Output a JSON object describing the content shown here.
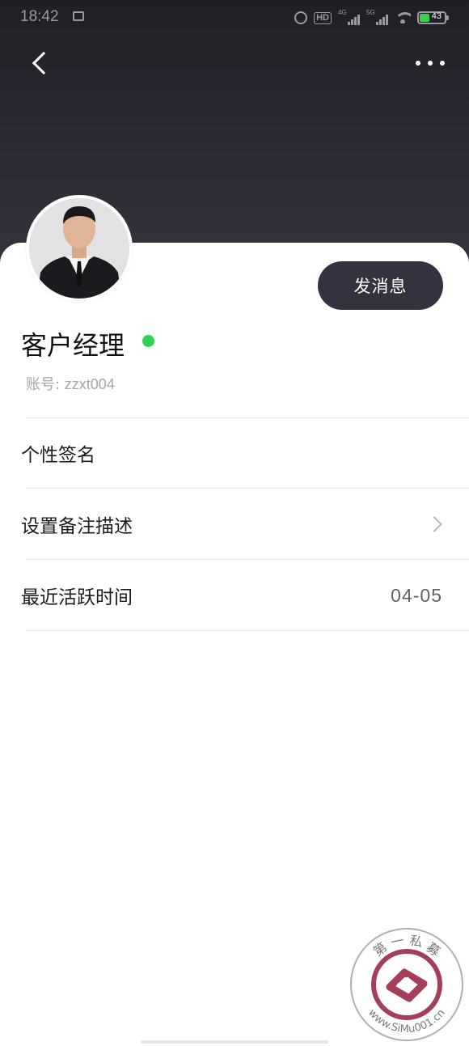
{
  "status_bar": {
    "time": "18:42",
    "hd_label": "HD",
    "net_4g": "4G",
    "net_5g": "5G",
    "battery": "43"
  },
  "nav": {
    "back_icon": "chevron-left-icon",
    "more_icon": "more-dots-icon"
  },
  "profile": {
    "name": "客户经理",
    "online": true,
    "online_color": "#2fd35a",
    "account_label": "账号: ",
    "account_id": "zzxt004",
    "send_message_label": "发消息"
  },
  "rows": [
    {
      "label": "个性签名",
      "value": ""
    },
    {
      "label": "设置备注描述",
      "value": "",
      "chevron": true
    },
    {
      "label": "最近活跃时间",
      "value": "04-05"
    }
  ],
  "watermark": {
    "text_top": "第 一 私 募",
    "text_bottom": "www.SiMu001.cn"
  },
  "colors": {
    "header_dark": "#2a2a33",
    "button_bg": "#34323f",
    "divider": "#e7e7ea"
  }
}
